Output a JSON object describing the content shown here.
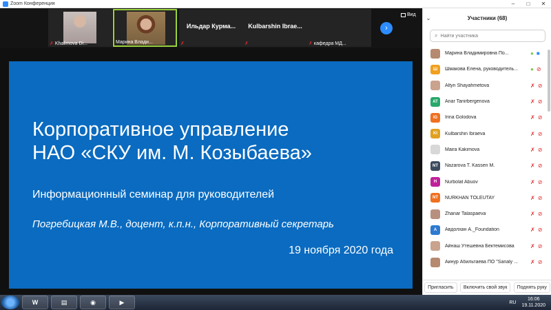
{
  "window": {
    "title": "Zoom Конференция"
  },
  "thumbnails": [
    {
      "name": "Khalimova Di...",
      "video": true,
      "muted": true
    },
    {
      "name": "Марина Влади...",
      "video": true,
      "muted": false,
      "active": true
    },
    {
      "name": "Ильдар Курма...",
      "video": false,
      "muted": true
    },
    {
      "name": "Kulbarshin Ibrae...",
      "video": false,
      "muted": true
    },
    {
      "name": "кафедра МД...",
      "video": false,
      "muted": true
    }
  ],
  "view_label": "Вид",
  "slide": {
    "title_line1": "Корпоративное управление",
    "title_line2": "НАО «СКУ им. М. Козыбаева»",
    "subtitle": "Информационный семинар для руководителей",
    "author": "Погребицкая М.В., доцент, к.п.н., Корпоративный секретарь",
    "date": "19 ноября 2020 года"
  },
  "participants_panel": {
    "title": "Участники (68)",
    "search_placeholder": "Найти участника",
    "participants": [
      {
        "initials": "",
        "name": "Марина Владимировна По...",
        "color": "#b58a70",
        "muted": false,
        "video": true
      },
      {
        "initials": "Ш",
        "name": "Шмакова Елена, руководитель...",
        "color": "#f0a020",
        "muted": false,
        "video": false
      },
      {
        "initials": "",
        "name": "Altyn Shayahmetova",
        "color": "#c9a38e",
        "muted": true,
        "video": false
      },
      {
        "initials": "AT",
        "name": "Anar Tanirbergenova",
        "color": "#27a86a",
        "muted": true,
        "video": false
      },
      {
        "initials": "IG",
        "name": "Irina Golodova",
        "color": "#f07020",
        "muted": true,
        "video": false
      },
      {
        "initials": "KI",
        "name": "Kulbarshin Ibraeva",
        "color": "#e0a020",
        "muted": true,
        "video": false
      },
      {
        "initials": "",
        "name": "Maira Kakimova",
        "color": "#d8d8d8",
        "muted": true,
        "video": false
      },
      {
        "initials": "NT",
        "name": "Nazarova T. Kassen M.",
        "color": "#3c4a5e",
        "muted": true,
        "video": false
      },
      {
        "initials": "H",
        "name": "Nurbolat Abuov",
        "color": "#c0209a",
        "muted": true,
        "video": false
      },
      {
        "initials": "NT",
        "name": "NURKHAN TOLEUTAY",
        "color": "#f07020",
        "muted": true,
        "video": false
      },
      {
        "initials": "",
        "name": "Zhanar Talaspaeva",
        "color": "#b89080",
        "muted": true,
        "video": false
      },
      {
        "initials": "A",
        "name": "Авдолхан А._Foundation",
        "color": "#2d7ad0",
        "muted": true,
        "video": false
      },
      {
        "initials": "",
        "name": "Айнаш Утешевна Бектемисова",
        "color": "#c9a38e",
        "muted": true,
        "video": false
      },
      {
        "initials": "",
        "name": "Аинур Абильтаева ПО \"Sanaly ...",
        "color": "#b58a70",
        "muted": true,
        "video": false
      }
    ],
    "footer": {
      "invite": "Пригласить",
      "unmute": "Включить свой звук",
      "raise": "Поднять руку"
    }
  },
  "taskbar": {
    "apps": [
      {
        "label": "W"
      },
      {
        "label": "▤"
      },
      {
        "label": "◉"
      },
      {
        "label": "▶"
      }
    ],
    "lang": "RU",
    "time": "16:06",
    "date": "19.11.2020"
  }
}
